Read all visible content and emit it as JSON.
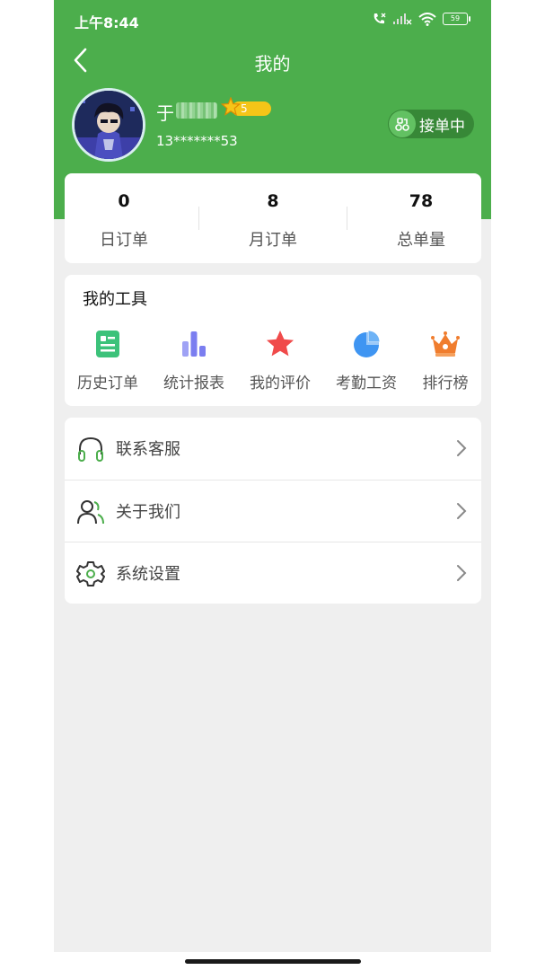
{
  "status_bar": {
    "time": "上午8:44",
    "battery": "59"
  },
  "header": {
    "title": "我的"
  },
  "profile": {
    "name": "于",
    "level": "5",
    "phone": "13*******53",
    "status": "接单中"
  },
  "stats": [
    {
      "value": "0",
      "label": "日订单"
    },
    {
      "value": "8",
      "label": "月订单"
    },
    {
      "value": "78",
      "label": "总单量"
    }
  ],
  "tools": {
    "title": "我的工具",
    "items": [
      {
        "label": "历史订单",
        "icon": "order-history-icon",
        "color": "#3cc27a"
      },
      {
        "label": "统计报表",
        "icon": "bar-chart-icon",
        "color": "#7b7ef0"
      },
      {
        "label": "我的评价",
        "icon": "star-icon",
        "color": "#f04a4a"
      },
      {
        "label": "考勤工资",
        "icon": "pie-chart-icon",
        "color": "#3f95f2"
      },
      {
        "label": "排行榜",
        "icon": "crown-icon",
        "color": "#f07d2e"
      }
    ]
  },
  "menu": [
    {
      "label": "联系客服",
      "icon": "headphones-icon"
    },
    {
      "label": "关于我们",
      "icon": "users-icon"
    },
    {
      "label": "系统设置",
      "icon": "settings-icon"
    }
  ],
  "colors": {
    "primary": "#4cae4c",
    "background": "#efefef"
  }
}
